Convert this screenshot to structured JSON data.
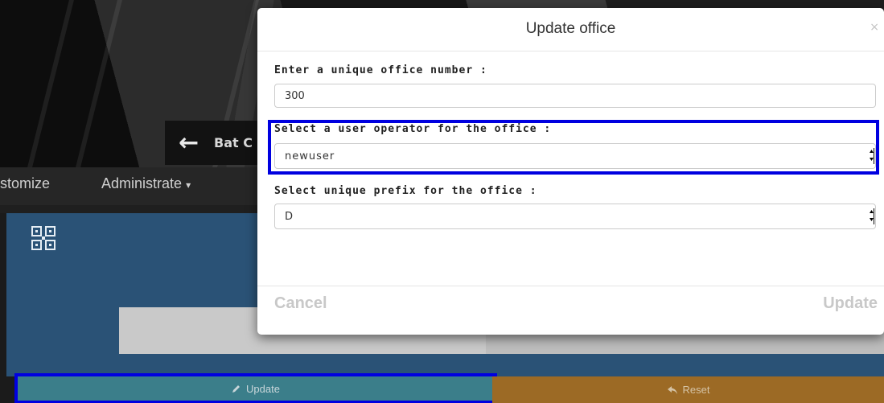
{
  "background": {
    "sign_text": "Bat C",
    "nav": {
      "customize_label": "stomize",
      "administrate_label": "Administrate",
      "caret": "▾"
    }
  },
  "page_actions": {
    "update_label": "Update",
    "update_icon": "pencil-icon",
    "reset_label": "Reset",
    "reset_icon": "reply-icon"
  },
  "modal": {
    "title": "Update office",
    "close_glyph": "×",
    "fields": {
      "office_number": {
        "label": "Enter a unique office number :",
        "value": "300"
      },
      "user_operator": {
        "label": "Select a user operator for the office :",
        "selected": "newuser"
      },
      "prefix": {
        "label": "Select unique prefix for the office :",
        "selected": "D"
      }
    },
    "footer": {
      "cancel_label": "Cancel",
      "submit_label": "Update"
    }
  },
  "colors": {
    "panel_blue": "#2a5276",
    "update_button": "#3b7e8a",
    "reset_button": "#9c6a25",
    "highlight_outline": "#0000e0"
  }
}
